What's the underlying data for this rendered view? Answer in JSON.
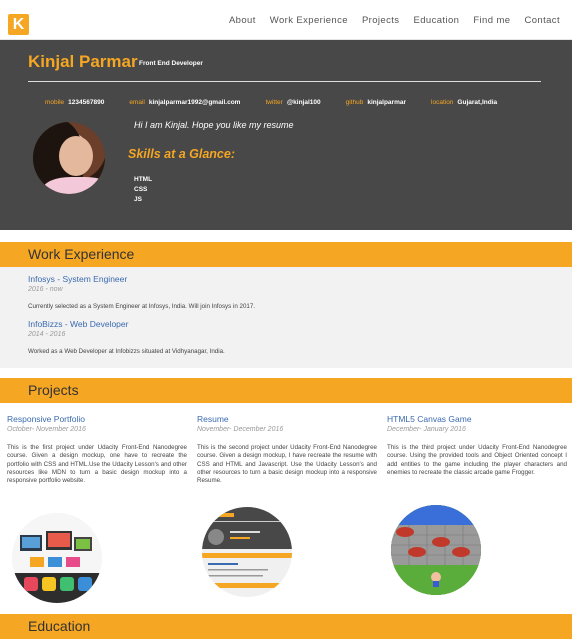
{
  "nav": {
    "logo": "K",
    "links": [
      "About",
      "Work Experience",
      "Projects",
      "Education",
      "Find me",
      "Contact"
    ]
  },
  "header": {
    "name": "Kinjal Parmar",
    "role": "Front End Developer",
    "contacts": [
      {
        "label": "mobile",
        "value": "1234567890"
      },
      {
        "label": "email",
        "value": "kinjalparmar1992@gmail.com"
      },
      {
        "label": "twitter",
        "value": "@kinjal100"
      },
      {
        "label": "github",
        "value": "kinjalparmar"
      },
      {
        "label": "location",
        "value": "Gujarat,India"
      }
    ],
    "welcome": "Hi I am Kinjal. Hope you like my resume",
    "skills_title": "Skills at a Glance:",
    "skills": [
      "HTML",
      "CSS",
      "JS"
    ]
  },
  "work": {
    "heading": "Work Experience",
    "jobs": [
      {
        "title": "Infosys - System Engineer",
        "dates": "2016 - now",
        "description": "Currently selected as a System Engineer at Infosys, India. Will join Infosys in 2017."
      },
      {
        "title": "InfoBizzs - Web Developer",
        "dates": "2014 - 2016",
        "description": "Worked as a Web Developer at Infobizzs situated at Vidhyanagar, India."
      }
    ]
  },
  "projects": {
    "heading": "Projects",
    "items": [
      {
        "title": "Responsive Portfolio",
        "dates": "October- November 2016",
        "description": "This is the first project under Udacity Front-End Nanodegree course. Given a design mockup, one have to recreate the portfolio with CSS and HTML.Use the Udacity Lesson's and other resources like MDN to turn a basic design mockup into a responsive portfolio website."
      },
      {
        "title": "Resume",
        "dates": "November- December 2016",
        "description": "This is the second project under Udacity Front-End Nanodegree course. Given a design mockup, I have recreate the resume with CSS and HTML and Javascript. Use the Udacity Lesson's and other resources to turn a basic design mockup into a responsive Resume."
      },
      {
        "title": "HTML5 Canvas Game",
        "dates": "December- January 2016",
        "description": "This is the third project under Udacity Front-End Nanodegree course. Using the provided tools and Object Oriented concept I add entities to the game including the player characters and enemies to recreate the classic arcade game Frogger."
      }
    ]
  },
  "education": {
    "heading": "Education"
  },
  "colors": {
    "accent": "#f5a623",
    "header_bg": "#484848",
    "link": "#3a6ab0"
  }
}
